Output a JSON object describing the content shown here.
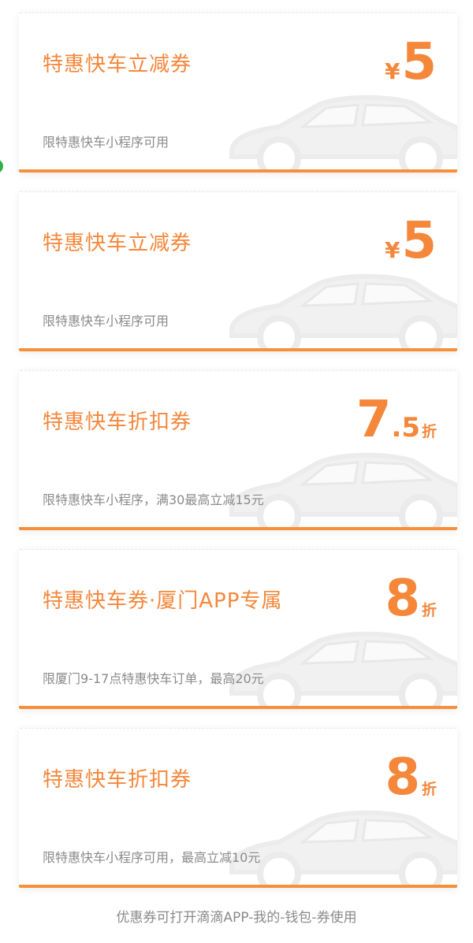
{
  "coupons": [
    {
      "title": "特惠快车立减券",
      "prefix": "¥",
      "main": "5",
      "decimal": "",
      "unit": "",
      "desc": "限特惠快车小程序可用"
    },
    {
      "title": "特惠快车立减券",
      "prefix": "¥",
      "main": "5",
      "decimal": "",
      "unit": "",
      "desc": "限特惠快车小程序可用"
    },
    {
      "title": "特惠快车折扣券",
      "prefix": "",
      "main": "7",
      "decimal": ".5",
      "unit": "折",
      "desc": "限特惠快车小程序，满30最高立减15元"
    },
    {
      "title": "特惠快车券·厦门APP专属",
      "prefix": "",
      "main": "8",
      "decimal": "",
      "unit": "折",
      "desc": "限厦门9-17点特惠快车订单，最高20元"
    },
    {
      "title": "特惠快车折扣券",
      "prefix": "",
      "main": "8",
      "decimal": "",
      "unit": "折",
      "desc": "限特惠快车小程序可用，最高立减10元"
    }
  ],
  "footer": "优惠券可打开滴滴APP-我的-钱包-券使用",
  "colors": {
    "accent": "#f5873b",
    "stripe": "#f7903a",
    "muted": "#8a8a8a"
  },
  "icons": {
    "card_background": "car-icon"
  }
}
